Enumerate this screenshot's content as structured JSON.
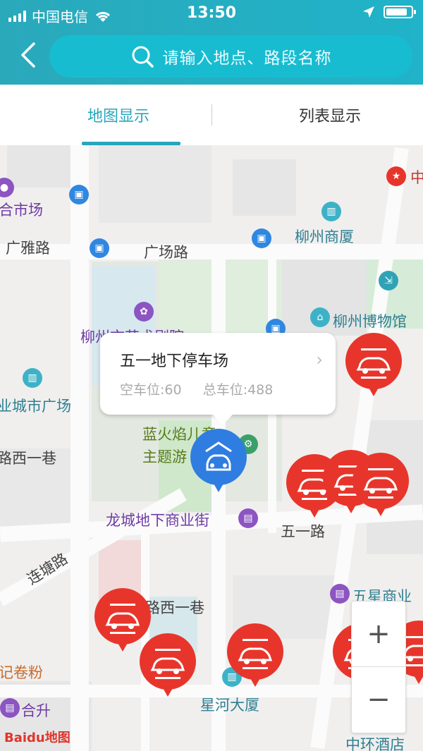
{
  "status_bar": {
    "carrier": "中国电信",
    "time": "13:50",
    "battery_level": 0.85
  },
  "search": {
    "placeholder": "请输入地点、路段名称"
  },
  "tabs": [
    {
      "label": "地图显示",
      "active": true
    },
    {
      "label": "列表显示",
      "active": false
    }
  ],
  "map_labels": {
    "l1": "合市场",
    "l2": "广雅路",
    "l3": "广场路",
    "l4": "柳州商厦",
    "l5": "柳州市艺术剧院",
    "l6": "柳州博物馆",
    "l7": "业城市广场",
    "l8": "路西一巷",
    "l9": "蓝火焰儿童",
    "l10": "主题游",
    "l11": "龙城地下商业街",
    "l12": "五一路",
    "l13": "连塘路",
    "l14": "路西一巷",
    "l15": "五星商业",
    "l16": "记卷粉",
    "l17": "合升",
    "l18": "星河大厦",
    "l19": "中环酒店",
    "l20": "中"
  },
  "popup": {
    "name": "五一地下停车场",
    "vacant_label": "空车位:60",
    "total_label": "总车位:488"
  },
  "zoom": {
    "in": "+",
    "out": "−"
  },
  "logo": "Baidu地图",
  "colors": {
    "header": "#22b0c4",
    "accent": "#26a6ba",
    "marker_red": "#e8352b",
    "marker_blue": "#2f7de1"
  }
}
